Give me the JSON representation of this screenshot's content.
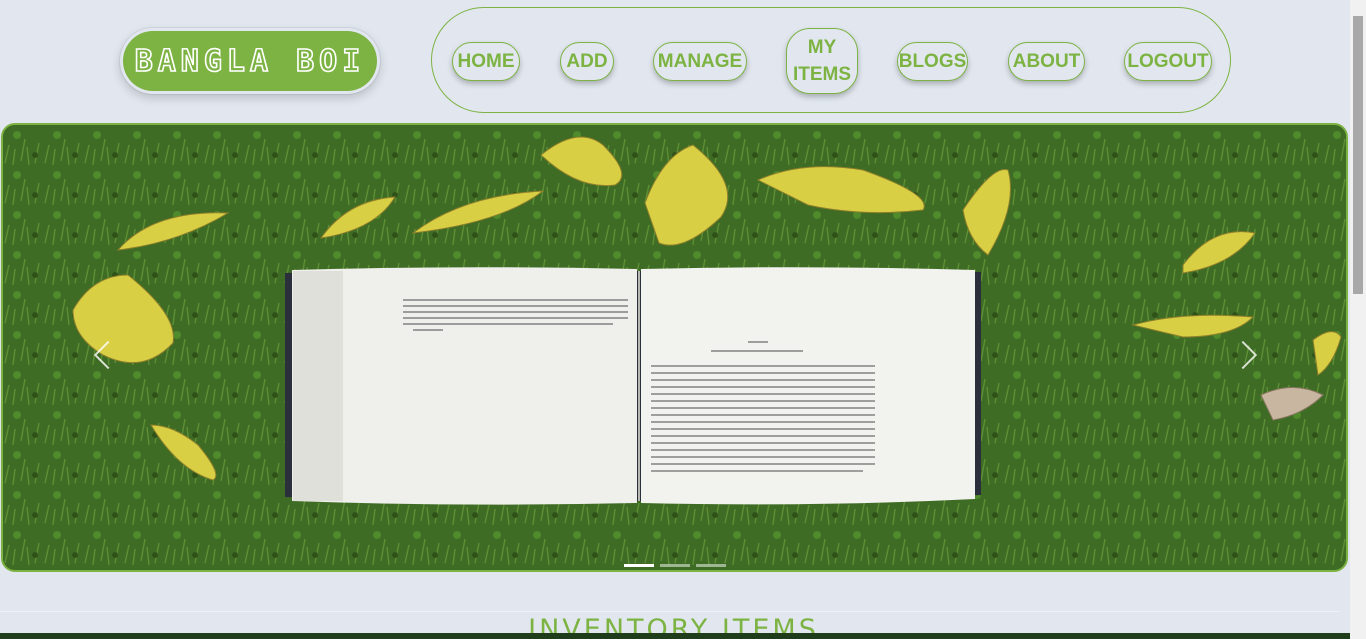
{
  "logo": {
    "text": "BANGLA BOI"
  },
  "nav": {
    "home": "HOME",
    "add": "ADD",
    "manage": "MANAGE",
    "my_items_line1": "MY",
    "my_items_line2": "ITEMS",
    "blogs": "BLOGS",
    "about": "ABOUT",
    "logout": "LOGOUT"
  },
  "carousel": {
    "slide_count": 3,
    "active_index": 0,
    "image_description": ""
  },
  "section": {
    "title": "INVENTORY ITEMS"
  },
  "colors": {
    "accent": "#7cb342",
    "background": "#e2e7ef",
    "footer": "#1f3d1a"
  }
}
